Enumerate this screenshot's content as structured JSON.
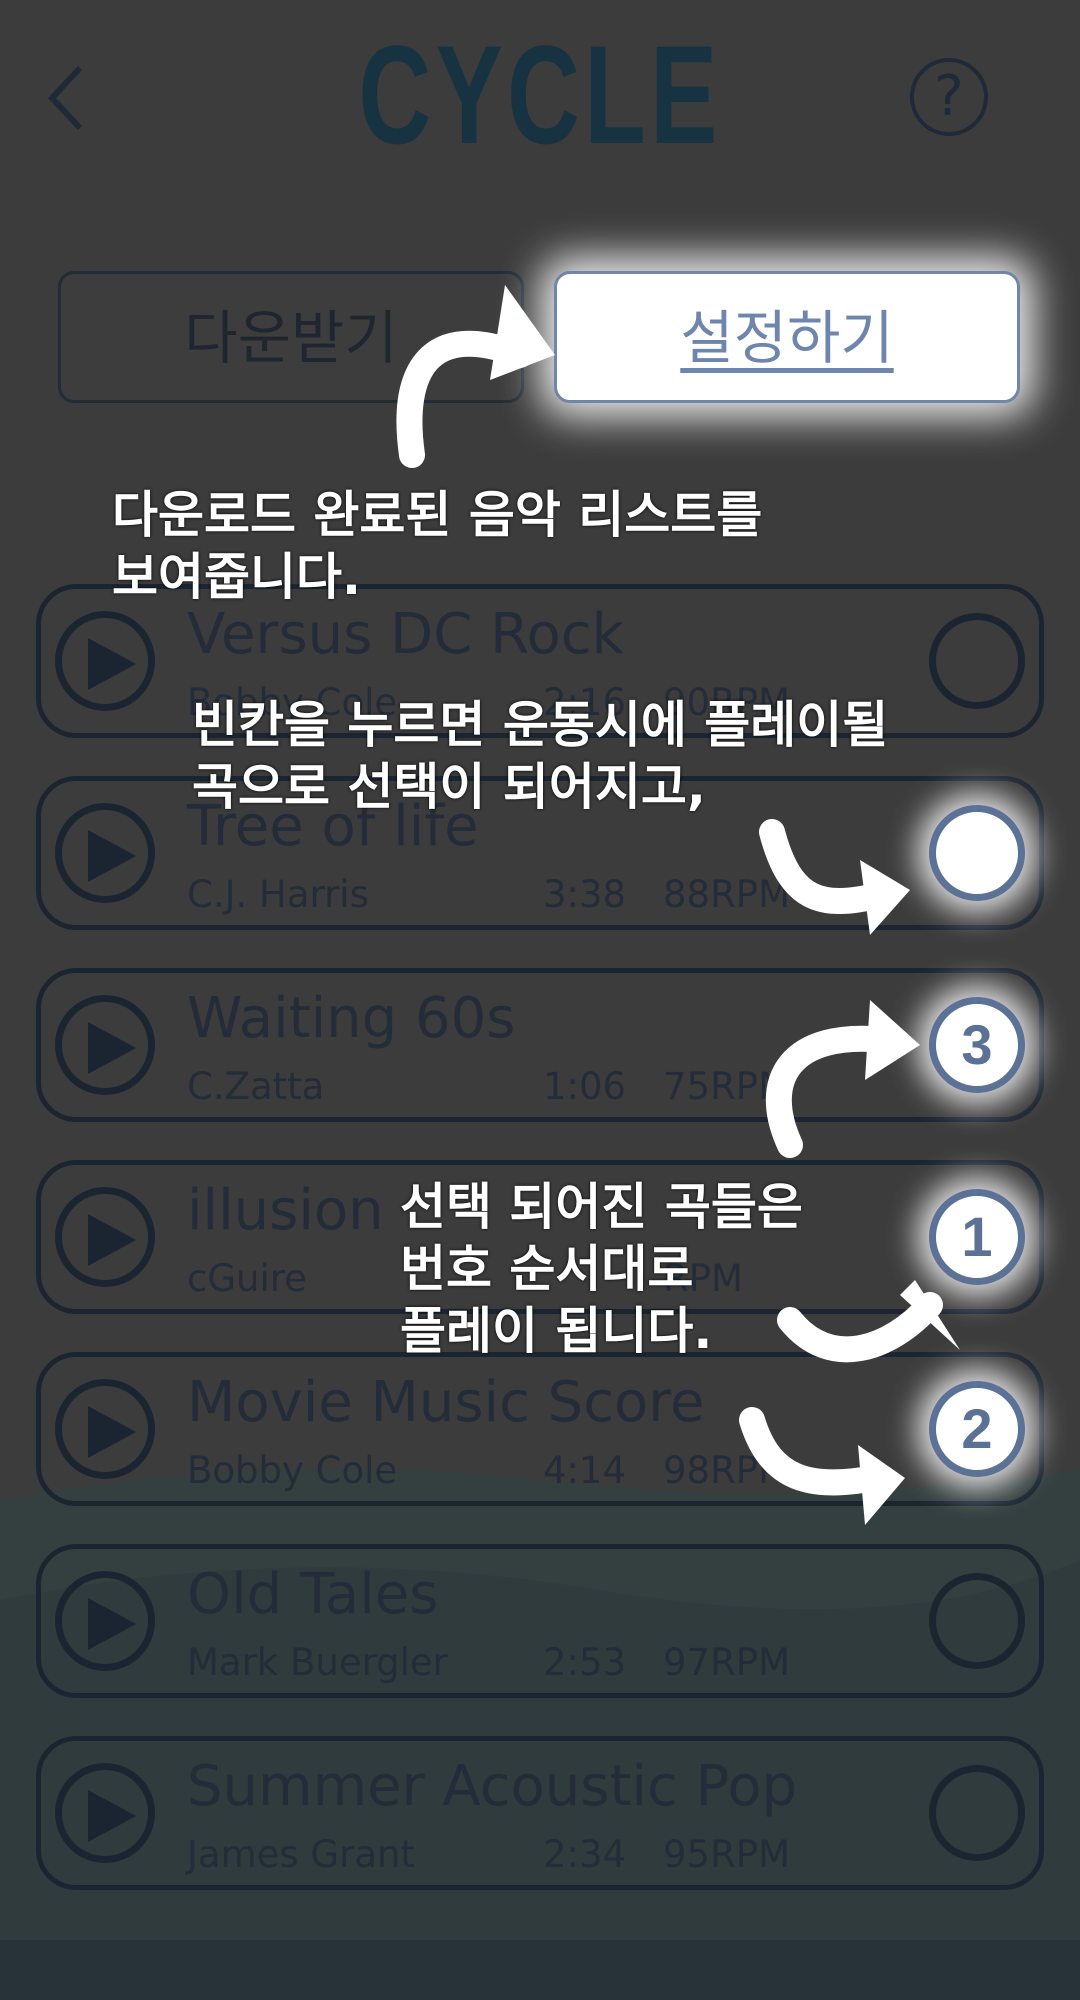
{
  "header": {
    "title": "CYCLE",
    "help_label": "?"
  },
  "tabs": {
    "download": "다운받기",
    "settings": "설정하기"
  },
  "songs": [
    {
      "title": "Versus DC Rock",
      "artist": "Bobby Cole",
      "duration": "2:16",
      "rpm": "90RPM",
      "order": ""
    },
    {
      "title": "Tree of life",
      "artist": "C.J. Harris",
      "duration": "3:38",
      "rpm": "88RPM",
      "order": ""
    },
    {
      "title": "Waiting 60s",
      "artist": "C.Zatta",
      "duration": "1:06",
      "rpm": "75RPM",
      "order": "3"
    },
    {
      "title": "illusion",
      "artist": "cGuire",
      "duration": "",
      "rpm": "RPM",
      "order": "1"
    },
    {
      "title": "Movie Music Score",
      "artist": "Bobby Cole",
      "duration": "4:14",
      "rpm": "98RPM",
      "order": "2"
    },
    {
      "title": "Old Tales",
      "artist": "Mark Buergler",
      "duration": "2:53",
      "rpm": "97RPM",
      "order": ""
    },
    {
      "title": "Summer Acoustic Pop",
      "artist": "James Grant",
      "duration": "2:34",
      "rpm": "95RPM",
      "order": ""
    }
  ],
  "annotations": {
    "a1_line1": "다운로드 완료된 음악 리스트를",
    "a1_line2": "보여줍니다.",
    "a2_line1": "빈칸을 누르면 운동시에 플레이될",
    "a2_line2": "곡으로 선택이 되어지고,",
    "a3_line1": "선택 되어진 곡들은",
    "a3_line2": "번호 순서대로",
    "a3_line3": "플레이 됩니다."
  },
  "colors": {
    "overlay": "#3c3c3c",
    "accent": "#5b7196",
    "title": "#173240",
    "outline": "#1b2532"
  }
}
